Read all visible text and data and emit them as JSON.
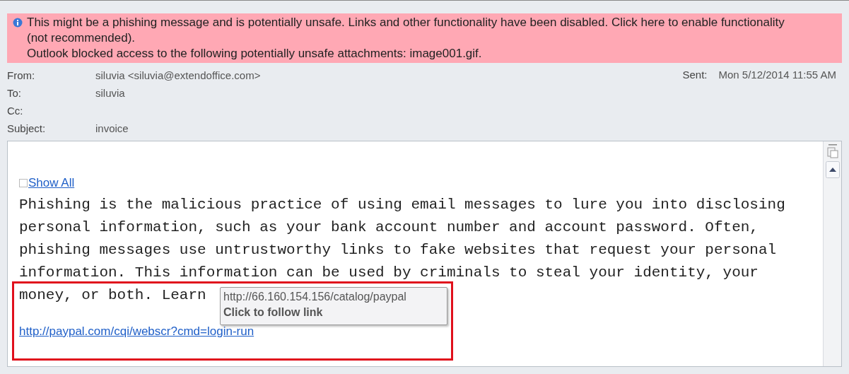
{
  "infobar": {
    "lines": [
      "This might be a phishing message and is potentially unsafe. Links and other functionality have been disabled. Click here to enable functionality (not recommended).",
      "Outlook blocked access to the following potentially unsafe attachments: image001.gif."
    ]
  },
  "header": {
    "fields": [
      {
        "label": "From:",
        "value": "siluvia <siluvia@extendoffice.com>"
      },
      {
        "label": "To:",
        "value": "siluvia"
      },
      {
        "label": "Cc:"
      },
      {
        "label": "Subject:",
        "value": "invoice"
      }
    ],
    "sent": {
      "label": "Sent:",
      "value": "Mon 5/12/2014 11:55 AM"
    }
  },
  "body": {
    "show_all": {
      "label": "Show All",
      "checked": false
    },
    "paragraph_lines": [
      "Phishing is the malicious practice of using email messages to lure you into disclosing",
      "personal information, such as your bank account number and account password. Often,",
      "phishing messages use untrustworthy links to fake websites that request your personal",
      "information. This information can be used by criminals to steal your identity, your",
      "money, or both. Learn"
    ],
    "link": "http://paypal.com/cqi/webscr?cmd=login-run",
    "tooltip": {
      "url": "http://66.160.154.156/catalog/paypal",
      "hint": "Click to follow link"
    }
  }
}
